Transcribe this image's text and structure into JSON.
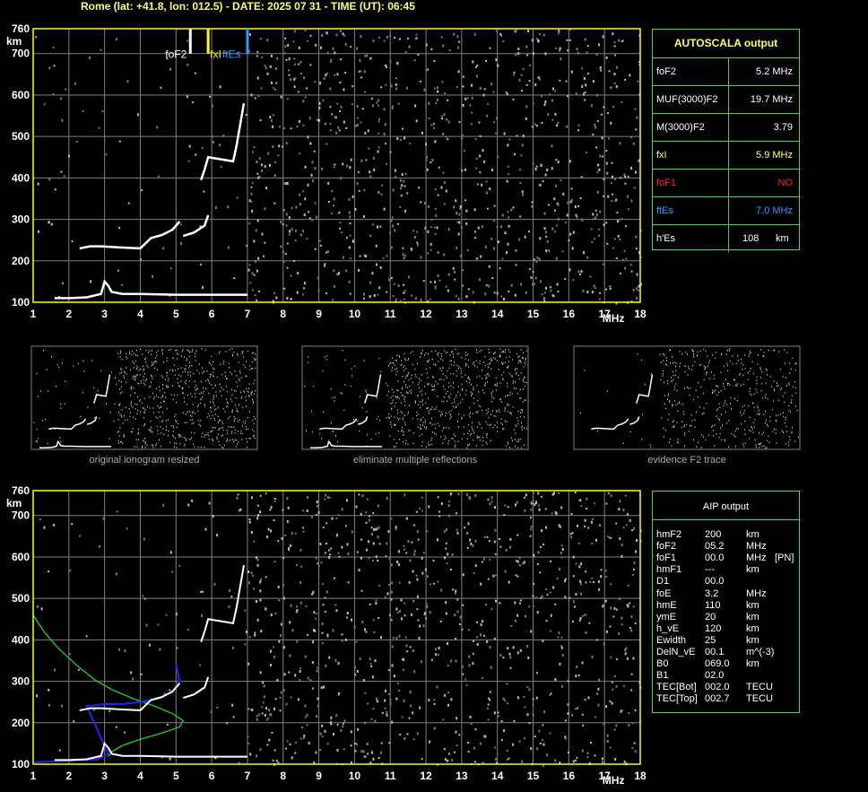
{
  "header": "Rome (lat: +41.8, lon: 012.5) - DATE: 2025 07 31 - TIME (UT): 06:45",
  "colors": {
    "frame": "#ffff00",
    "grid": "#808080",
    "trace": "#ffffff",
    "fof2_marker": "#ffffff",
    "fxi_marker": "#ffff00",
    "ftes_marker": "#3399ff",
    "profile": "#22dd22",
    "aip_trace": "#2222ff",
    "table_border": "#55cc55",
    "no_value": "#ff2222"
  },
  "chart_data": [
    {
      "type": "scatter",
      "name_in_image": "top ionogram",
      "xlim": [
        1,
        18
      ],
      "ylim": [
        100,
        760
      ],
      "x_ticks": [
        "1",
        "2",
        "3",
        "4",
        "5",
        "6",
        "7",
        "8",
        "9",
        "10",
        "11",
        "12",
        "13",
        "14",
        "15",
        "16",
        "17",
        "18"
      ],
      "y_ticks": [
        "100",
        "200",
        "300",
        "400",
        "500",
        "600",
        "700",
        "760"
      ],
      "xunit": "MHz",
      "yunit": "km",
      "markers": [
        {
          "label": "foF2",
          "x": 5.2
        },
        {
          "label": "fxI",
          "x": 5.9
        },
        {
          "label": "ftEs",
          "x": 7.0
        }
      ],
      "traces": [
        {
          "name": "E/Es",
          "points": [
            [
              1.6,
              110
            ],
            [
              2,
              110
            ],
            [
              2.5,
              112
            ],
            [
              2.9,
              120
            ],
            [
              3.0,
              150
            ],
            [
              3.1,
              140
            ],
            [
              3.2,
              125
            ],
            [
              3.5,
              120
            ],
            [
              4,
              120
            ],
            [
              5,
              118
            ],
            [
              6,
              118
            ],
            [
              7,
              118
            ]
          ]
        },
        {
          "name": "F1/F2 o",
          "points": [
            [
              2.3,
              230
            ],
            [
              2.6,
              235
            ],
            [
              2.9,
              235
            ],
            [
              3.5,
              232
            ],
            [
              4.0,
              230
            ],
            [
              4.3,
              255
            ],
            [
              4.6,
              262
            ],
            [
              4.9,
              275
            ],
            [
              5.1,
              295
            ]
          ]
        },
        {
          "name": "F2 x",
          "points": [
            [
              5.2,
              260
            ],
            [
              5.5,
              268
            ],
            [
              5.8,
              285
            ],
            [
              5.9,
              310
            ]
          ]
        },
        {
          "name": "F2 high",
          "points": [
            [
              5.7,
              395
            ],
            [
              5.8,
              420
            ],
            [
              5.9,
              450
            ],
            [
              6.6,
              440
            ],
            [
              6.7,
              480
            ],
            [
              6.8,
              530
            ],
            [
              6.9,
              580
            ]
          ]
        }
      ]
    },
    {
      "type": "scatter",
      "name_in_image": "bottom ionogram with profile",
      "xlim": [
        1,
        18
      ],
      "ylim": [
        100,
        760
      ],
      "x_ticks": [
        "1",
        "2",
        "3",
        "4",
        "5",
        "6",
        "7",
        "8",
        "9",
        "10",
        "11",
        "12",
        "13",
        "14",
        "15",
        "16",
        "17",
        "18"
      ],
      "y_ticks": [
        "100",
        "200",
        "300",
        "400",
        "500",
        "600",
        "700",
        "760"
      ],
      "xunit": "MHz",
      "yunit": "km",
      "profile": [
        [
          1.0,
          460
        ],
        [
          1.3,
          420
        ],
        [
          1.7,
          380
        ],
        [
          2.2,
          340
        ],
        [
          2.7,
          305
        ],
        [
          3.2,
          280
        ],
        [
          3.8,
          258
        ],
        [
          4.4,
          240
        ],
        [
          4.9,
          222
        ],
        [
          5.2,
          205
        ],
        [
          5.1,
          190
        ],
        [
          4.6,
          175
        ],
        [
          4.0,
          160
        ],
        [
          3.5,
          145
        ],
        [
          3.2,
          130
        ],
        [
          3.1,
          118
        ]
      ],
      "aip_trace": [
        [
          1,
          105
        ],
        [
          2,
          108
        ],
        [
          2.8,
          112
        ],
        [
          3.1,
          125
        ],
        [
          2.5,
          240
        ],
        [
          3.0,
          245
        ],
        [
          3.5,
          245
        ],
        [
          4.0,
          250
        ],
        [
          4.5,
          258
        ],
        [
          4.9,
          275
        ],
        [
          5.1,
          300
        ],
        [
          5.0,
          340
        ]
      ]
    }
  ],
  "autoscala": {
    "title": "AUTOSCALA output",
    "rows": [
      {
        "label": "foF2",
        "value": "5.2 MHz",
        "color": "#ffffff"
      },
      {
        "label": "MUF(3000)F2",
        "value": "19.7 MHz",
        "color": "#ffffff"
      },
      {
        "label": "M(3000)F2",
        "value": "3.79",
        "color": "#ffffff"
      },
      {
        "label": "fxI",
        "value": "5.9 MHz",
        "color": "#ffff66"
      },
      {
        "label": "foF1",
        "value": "NO",
        "color": "#ff2222"
      },
      {
        "label": "ftEs",
        "value": "7.0 MHz",
        "color": "#3399ff"
      },
      {
        "label": "h'Es",
        "value": "108",
        "unit": "km",
        "color": "#ffffff"
      }
    ]
  },
  "panels": [
    {
      "caption": "original ionogram resized"
    },
    {
      "caption": "eliminate multiple reflections"
    },
    {
      "caption": "evidence F2 trace"
    }
  ],
  "aip": {
    "title": "AIP output",
    "rows": [
      {
        "label": "hmF2",
        "value": "200",
        "unit": "km",
        "extra": ""
      },
      {
        "label": "foF2",
        "value": "05.2",
        "unit": "MHz",
        "extra": ""
      },
      {
        "label": "foF1",
        "value": "00.0",
        "unit": "MHz",
        "extra": "[PN]"
      },
      {
        "label": "hmF1",
        "value": "---",
        "unit": "km",
        "extra": ""
      },
      {
        "label": "D1",
        "value": "00.0",
        "unit": "",
        "extra": ""
      },
      {
        "label": "foE",
        "value": "3.2",
        "unit": "MHz",
        "extra": ""
      },
      {
        "label": "hmE",
        "value": "110",
        "unit": "km",
        "extra": ""
      },
      {
        "label": "ymE",
        "value": "20",
        "unit": "km",
        "extra": ""
      },
      {
        "label": "h_vE",
        "value": "120",
        "unit": "km",
        "extra": ""
      },
      {
        "label": "Ewidth",
        "value": "25",
        "unit": "km",
        "extra": ""
      },
      {
        "label": "DelN_vE",
        "value": "00.1",
        "unit": "m^(-3)",
        "extra": ""
      },
      {
        "label": "B0",
        "value": "069.0",
        "unit": "km",
        "extra": ""
      },
      {
        "label": "B1",
        "value": "02.0",
        "unit": "",
        "extra": ""
      },
      {
        "label": "TEC[Bot]",
        "value": "002.0",
        "unit": "TECU",
        "extra": ""
      },
      {
        "label": "TEC[Top]",
        "value": "002.7",
        "unit": "TECU",
        "extra": ""
      }
    ]
  }
}
